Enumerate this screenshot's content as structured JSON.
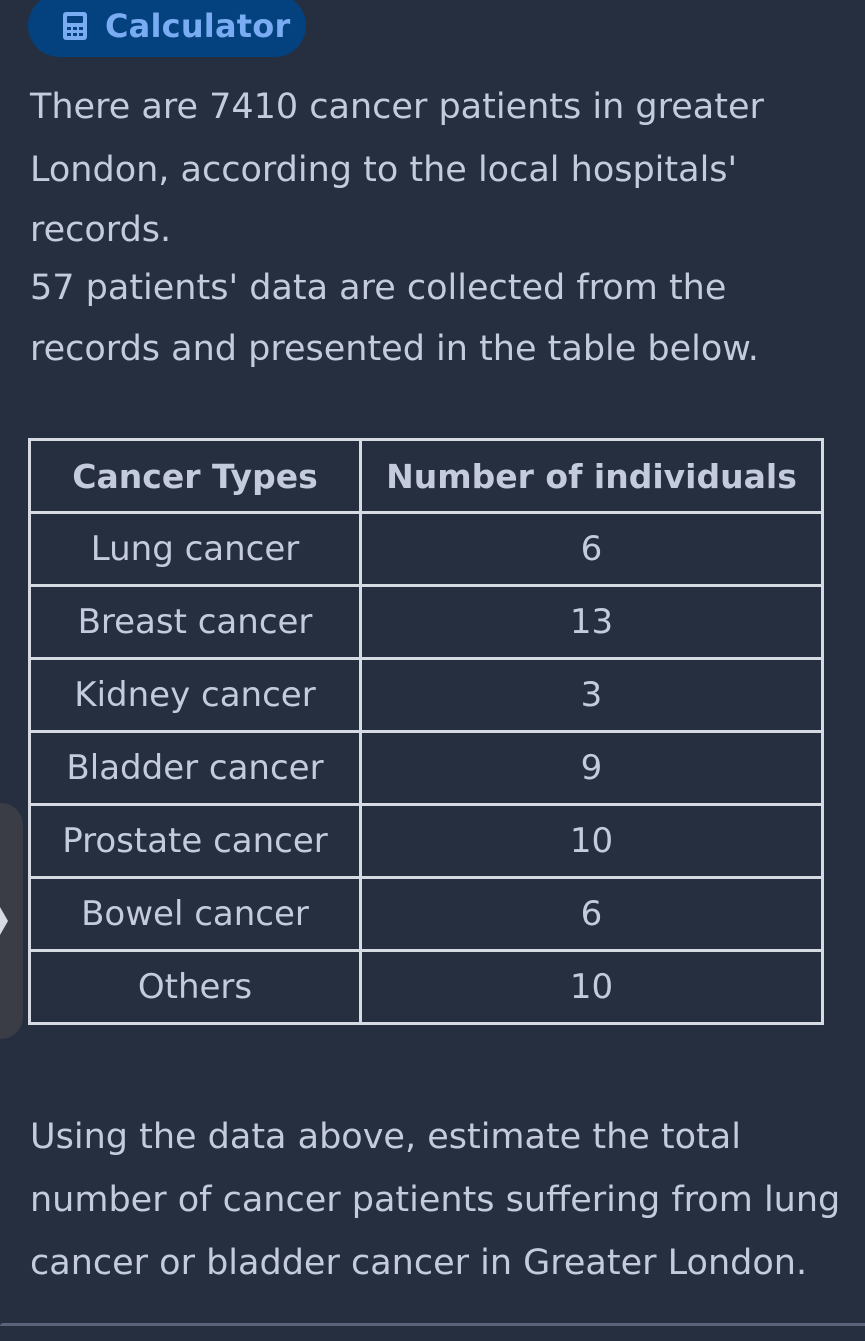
{
  "toolbar": {
    "calculator_label": "Calculator",
    "calculator_icon": "calculator-icon"
  },
  "intro": {
    "lines": [
      "There are 7410 cancer patients in greater",
      "London, according to the local hospitals'",
      "records.",
      "57 patients' data are collected from the",
      "records and presented in the table below."
    ]
  },
  "table": {
    "headers": [
      "Cancer Types",
      "Number of individuals"
    ],
    "rows": [
      [
        "Lung cancer",
        "6"
      ],
      [
        "Breast cancer",
        "13"
      ],
      [
        "Kidney cancer",
        "3"
      ],
      [
        "Bladder cancer",
        "9"
      ],
      [
        "Prostate cancer",
        "10"
      ],
      [
        "Bowel cancer",
        "6"
      ],
      [
        "Others",
        "10"
      ]
    ]
  },
  "question": {
    "lines": [
      "Using the data above, estimate the total",
      "number of cancer patients suffering from lung",
      "cancer or bladder cancer in Greater London."
    ]
  },
  "side_tab": {
    "icon": "chevron-right-icon"
  },
  "colors": {
    "background": "#262f40",
    "text": "#c3cbdc",
    "button_bg": "#03417f",
    "button_text": "#79acf2",
    "table_border": "#d6dbe3"
  }
}
